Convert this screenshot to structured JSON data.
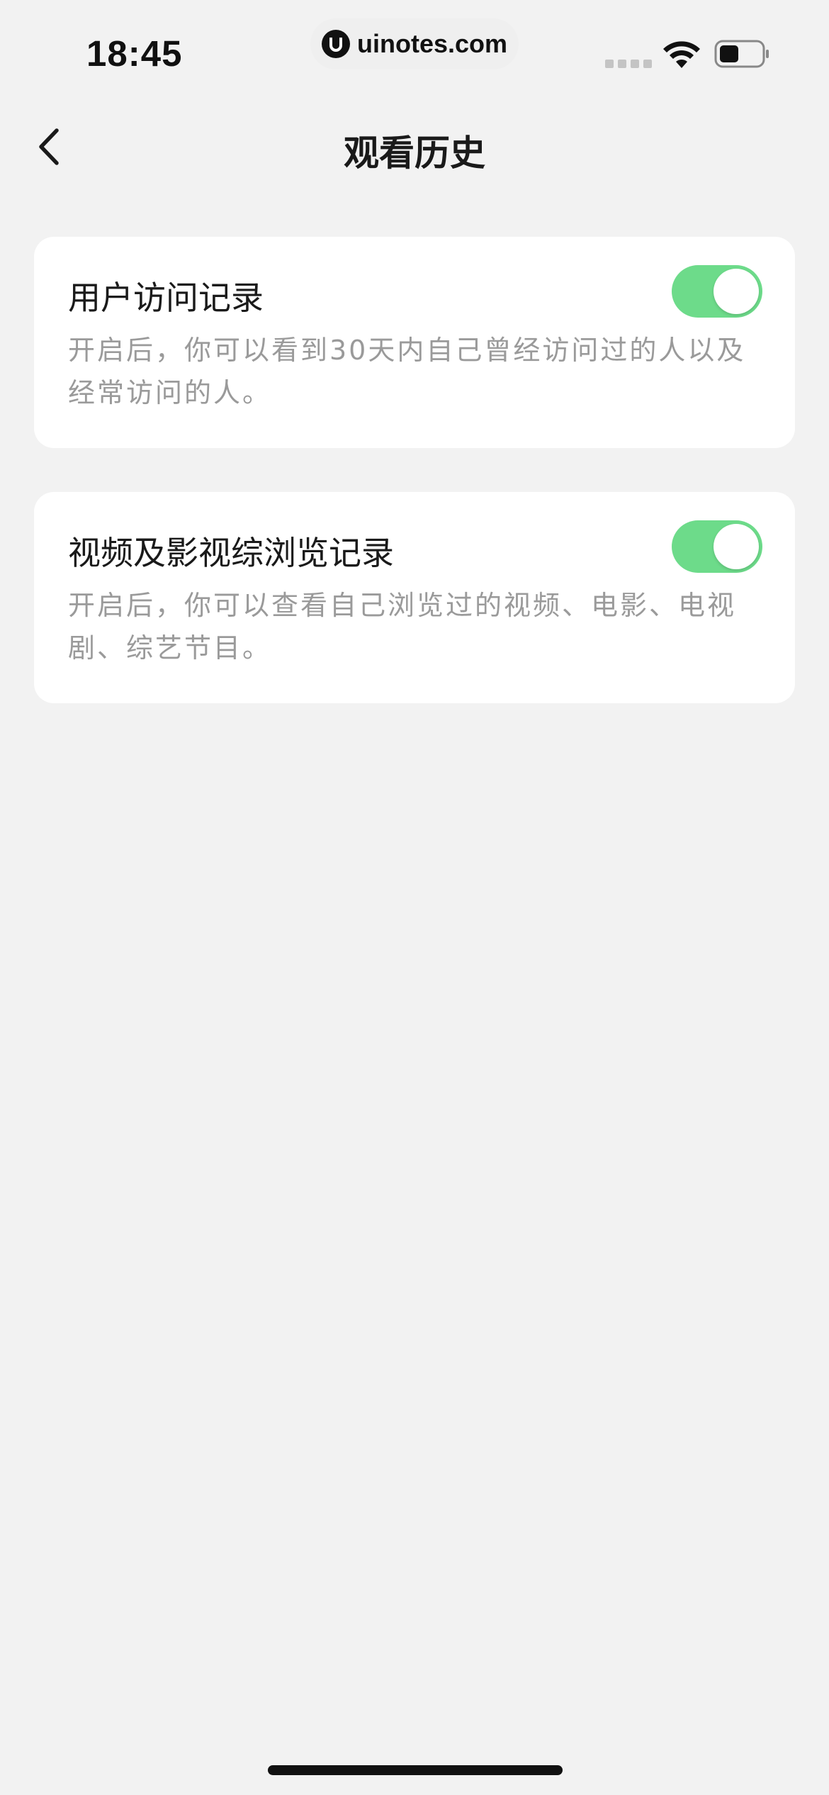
{
  "status_bar": {
    "time": "18:45",
    "url": "uinotes.com",
    "icons": [
      "cellular-signal-icon",
      "wifi-icon",
      "battery-icon"
    ]
  },
  "nav": {
    "back_icon": "chevron-left-icon",
    "title": "观看历史"
  },
  "settings": [
    {
      "title": "用户访问记录",
      "description": "开启后，你可以看到30天内自己曾经访问过的人以及经常访问的人。",
      "enabled": true
    },
    {
      "title": "视频及影视综浏览记录",
      "description": "开启后，你可以查看自己浏览过的视频、电影、电视剧、综艺节目。",
      "enabled": true
    }
  ],
  "colors": {
    "background": "#f2f2f2",
    "card": "#ffffff",
    "toggle_on": "#6ddb8a",
    "title_text": "#1a1a1a",
    "description_text": "#9a9a9a"
  }
}
